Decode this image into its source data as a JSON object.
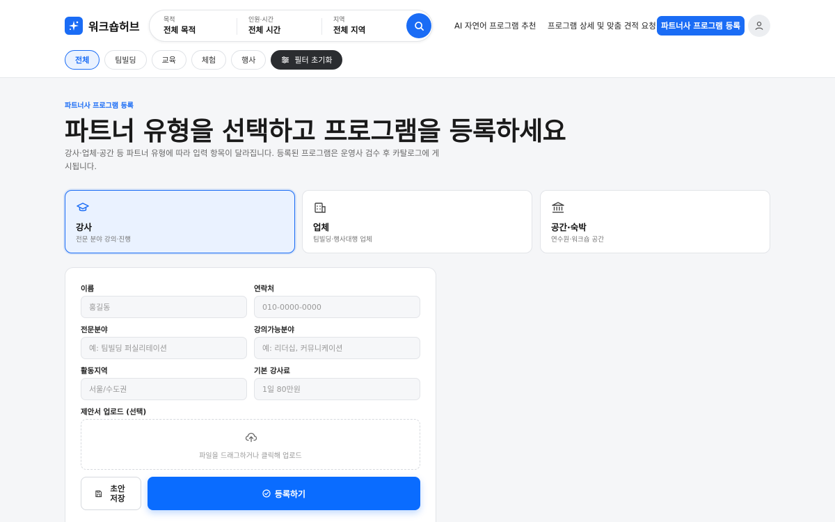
{
  "brand": {
    "name": "워크숍허브",
    "accent": "#1a6cf5"
  },
  "search": {
    "purpose": {
      "label": "목적",
      "value": "전체 목적"
    },
    "people": {
      "label": "인원·시간",
      "value": "전체 시간"
    },
    "region": {
      "label": "지역",
      "value": "전체 지역"
    },
    "icon": "search-icon"
  },
  "nav": {
    "ai": "AI 자연어 프로그램 추천",
    "quote": "프로그램 상세 및 맞춤 견적 요청",
    "register": "파트너사 프로그램 등록",
    "profile_icon": "user-icon"
  },
  "filters": {
    "chips": [
      "전체",
      "팀빌딩",
      "교육",
      "체험",
      "행사"
    ],
    "active": "전체",
    "reset": "필터 초기화"
  },
  "intro": {
    "eyebrow": "파트너사 프로그램 등록",
    "title": "파트너 유형을 선택하고 프로그램을 등록하세요",
    "lead": "강사·업체·공간 등 파트너 유형에 따라 입력 항목이 달라집니다. 등록된 프로그램은 운영사 검수 후 카탈로그에 게시됩니다."
  },
  "partner_types": [
    {
      "title": "강사",
      "desc": "전문 분야 강의·진행",
      "icon": "graduation-cap-icon",
      "selected": true
    },
    {
      "title": "업체",
      "desc": "팀빌딩·행사대행 업체",
      "icon": "building-icon",
      "selected": false
    },
    {
      "title": "공간·숙박",
      "desc": "연수원·워크숍 공간",
      "icon": "landmark-icon",
      "selected": false
    }
  ],
  "form": {
    "name": {
      "label": "이름",
      "placeholder": "홍길동"
    },
    "contact": {
      "label": "연락처",
      "placeholder": "010-0000-0000"
    },
    "specialty": {
      "label": "전문분야",
      "placeholder": "예: 팀빌딩 퍼실리테이션"
    },
    "topics": {
      "label": "강의가능분야",
      "placeholder": "예: 리더십, 커뮤니케이션"
    },
    "area": {
      "label": "활동지역",
      "placeholder": "서울/수도권"
    },
    "fee": {
      "label": "기본 강사료",
      "placeholder": "1일 80만원"
    },
    "upload": {
      "label": "제안서 업로드 (선택)",
      "hint": "파일을 드래그하거나 클릭해 업로드"
    },
    "draft": "초안 저장",
    "submit": "등록하기"
  }
}
